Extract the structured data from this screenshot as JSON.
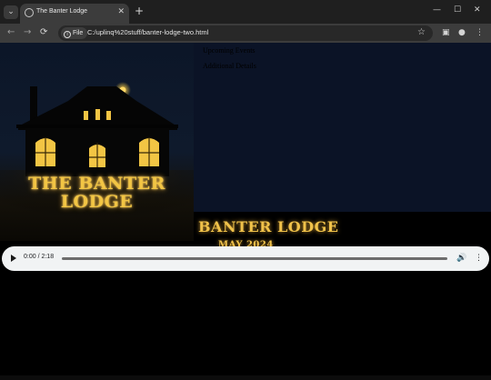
{
  "browser": {
    "tab_title": "The Banter Lodge",
    "tab_close": "✕",
    "new_tab": "+",
    "window_controls": {
      "minimize": "—",
      "maximize": "☐",
      "close": "✕"
    },
    "nav": {
      "back": "←",
      "forward": "→",
      "reload": "⟳"
    },
    "site_chip": "File",
    "url": "C:/uplinq%20stuff/banter-lodge-two.html",
    "icons": {
      "bookmark": "star-icon",
      "side_panel": "side-panel-icon",
      "profile": "profile-icon",
      "menu": "kebab-menu-icon"
    }
  },
  "page": {
    "links": [
      "Upcoming Events",
      "Additional Details"
    ],
    "poster": {
      "title_line1": "THE BANTER",
      "title_line2": "LODGE"
    },
    "event_title": "BANTER LODGE",
    "event_date": "MAY 2024",
    "colors": {
      "gold": "#f2c544",
      "navy": "#0b1326",
      "background": "#000000"
    }
  },
  "audio": {
    "current_time": "0:00",
    "separator": " / ",
    "duration": "2:18",
    "progress": 0
  }
}
